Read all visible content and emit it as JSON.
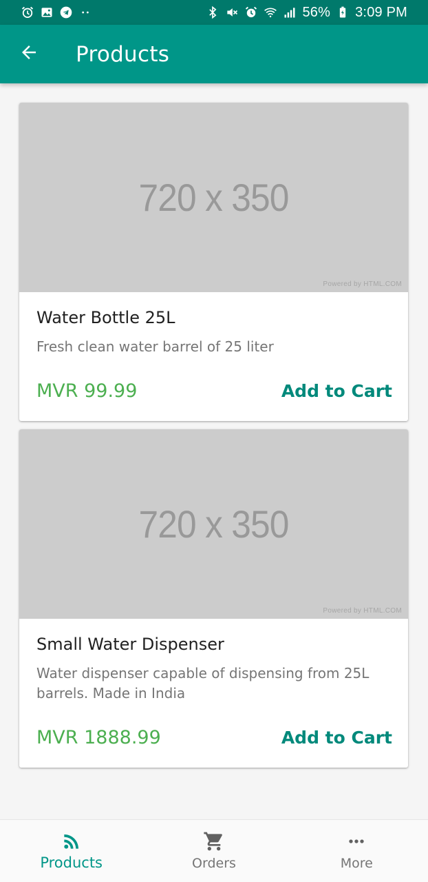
{
  "status_bar": {
    "battery": "56%",
    "time": "3:09 PM",
    "left_icons": [
      "alarm-icon",
      "image-icon",
      "telegram-icon",
      "more-dots-icon"
    ],
    "right_icons": [
      "bluetooth-icon",
      "mute-icon",
      "alarm-icon",
      "wifi-icon",
      "signal-icon",
      "battery-icon"
    ]
  },
  "app_bar": {
    "title": "Products",
    "back_icon": "arrow-back-icon",
    "color": "#009688"
  },
  "products": [
    {
      "image_text": "720 x 350",
      "image_credit": "Powered by HTML.COM",
      "name": "Water Bottle 25L",
      "description": "Fresh clean water barrel of 25 liter",
      "price": "MVR 99.99",
      "action": "Add to Cart"
    },
    {
      "image_text": "720 x 350",
      "image_credit": "Powered by HTML.COM",
      "name": "Small Water Dispenser",
      "description": "Water dispenser capable of dispensing from 25L barrels. Made in India",
      "price": "MVR 1888.99",
      "action": "Add to Cart"
    }
  ],
  "bottom_nav": {
    "items": [
      {
        "label": "Products",
        "icon": "rss-feed-icon",
        "active": true
      },
      {
        "label": "Orders",
        "icon": "cart-icon",
        "active": false
      },
      {
        "label": "More",
        "icon": "more-horiz-icon",
        "active": false
      }
    ]
  },
  "colors": {
    "primary": "#009688",
    "primary_dark": "#00796b",
    "price_green": "#4caf50",
    "action_teal": "#00897b"
  }
}
